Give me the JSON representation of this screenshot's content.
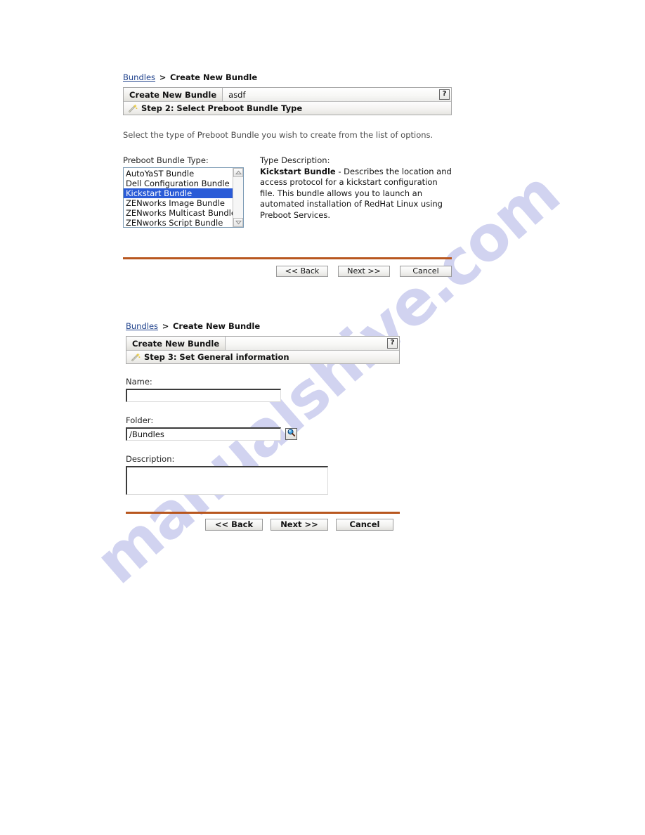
{
  "watermark": {
    "text": "manualshive.com"
  },
  "screen1": {
    "breadcrumb": {
      "link": "Bundles",
      "separator": ">",
      "current": "Create New Bundle"
    },
    "panel": {
      "tab_label": "Create New Bundle",
      "tab_value": "asdf",
      "help_label": "?",
      "wizard_icon": "magic-wand-icon",
      "step_title": "Step 2: Select Preboot Bundle Type"
    },
    "instruction": "Select the type of Preboot Bundle you wish to create from the list of options.",
    "listbox": {
      "label": "Preboot Bundle Type:",
      "items": [
        "AutoYaST Bundle",
        "Dell Configuration Bundle",
        "Kickstart Bundle",
        "ZENworks Image Bundle",
        "ZENworks Multicast Bundle",
        "ZENworks Script Bundle"
      ],
      "selected_index": 2,
      "scroll_up_icon": "chevron-up-icon",
      "scroll_down_icon": "chevron-down-icon"
    },
    "type_description": {
      "label": "Type Description:",
      "term": "Kickstart Bundle",
      "text": " - Describes the location and access protocol for a kickstart configuration file. This bundle allows you to launch an automated installation of RedHat Linux using Preboot Services."
    },
    "buttons": {
      "back": "<< Back",
      "next": "Next >>",
      "cancel": "Cancel"
    }
  },
  "screen2": {
    "breadcrumb": {
      "link": "Bundles",
      "separator": ">",
      "current": "Create New Bundle"
    },
    "panel": {
      "tab_label": "Create New Bundle",
      "tab_value": "",
      "help_label": "?",
      "wizard_icon": "magic-wand-icon",
      "step_title": "Step 3: Set General information"
    },
    "form": {
      "name_label": "Name:",
      "name_value": "",
      "folder_label": "Folder:",
      "folder_value": "/Bundles",
      "folder_browse_icon": "magnifier-icon",
      "description_label": "Description:",
      "description_value": ""
    },
    "buttons": {
      "back": "<< Back",
      "next": "Next >>",
      "cancel": "Cancel"
    }
  },
  "colors": {
    "divider_orange": "#b8571f",
    "selection_blue": "#2a5bd7",
    "link_blue": "#20428c",
    "watermark": "#c9ccee"
  }
}
